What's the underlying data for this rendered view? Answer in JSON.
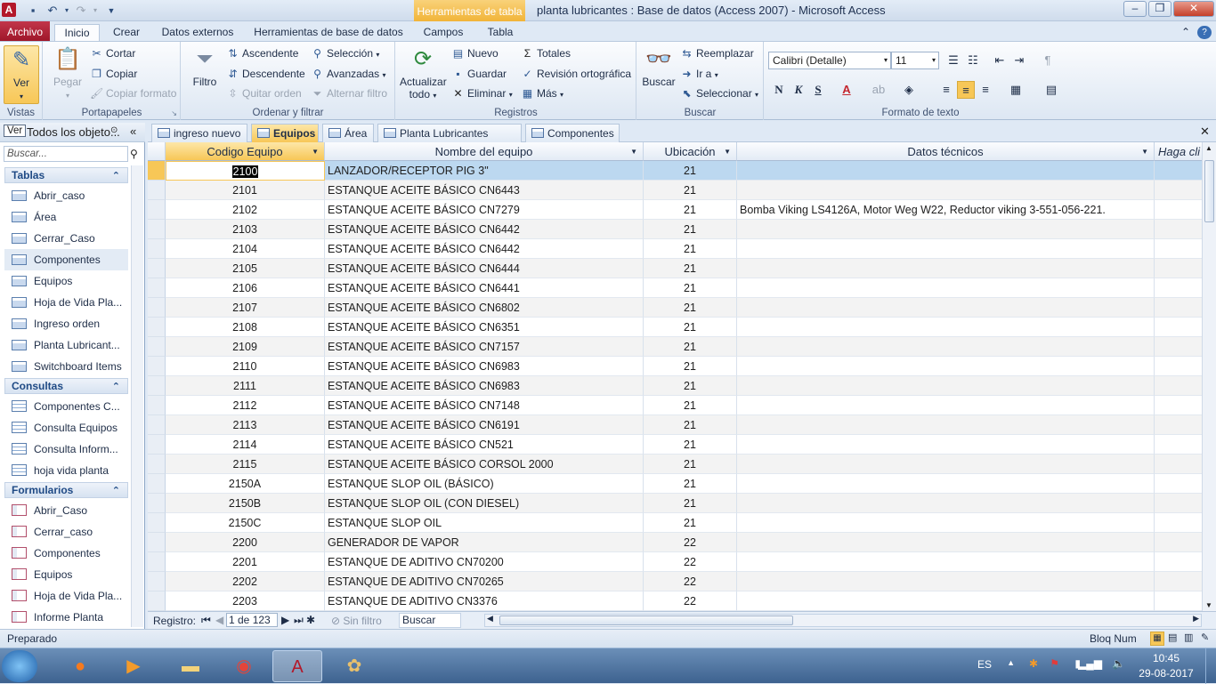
{
  "window": {
    "app_title": "planta lubricantes : Base de datos (Access 2007)  -  Microsoft Access",
    "contextual_header": "Herramientas de tabla",
    "app_icon_letter": "A"
  },
  "ribbon_tabs": [
    "Archivo",
    "Inicio",
    "Crear",
    "Datos externos",
    "Herramientas de base de datos",
    "Campos",
    "Tabla"
  ],
  "ribbon": {
    "vistas": {
      "label": "Vistas",
      "ver": "Ver"
    },
    "portapapeles": {
      "label": "Portapapeles",
      "pegar": "Pegar",
      "cortar": "Cortar",
      "copiar": "Copiar",
      "copiar_formato": "Copiar formato"
    },
    "ordenar": {
      "label": "Ordenar y filtrar",
      "filtro": "Filtro",
      "ascendente": "Ascendente",
      "descendente": "Descendente",
      "quitar_orden": "Quitar orden",
      "seleccion": "Selección",
      "avanzadas": "Avanzadas",
      "alternar_filtro": "Alternar filtro"
    },
    "registros": {
      "label": "Registros",
      "actualizar": "Actualizar",
      "todo": "todo",
      "nuevo": "Nuevo",
      "guardar": "Guardar",
      "eliminar": "Eliminar",
      "totales": "Totales",
      "revision": "Revisión ortográfica",
      "mas": "Más"
    },
    "buscar": {
      "label": "Buscar",
      "buscar": "Buscar",
      "reemplazar": "Reemplazar",
      "ir_a": "Ir a",
      "seleccionar": "Seleccionar"
    },
    "formato": {
      "label": "Formato de texto",
      "font_name": "Calibri (Detalle)",
      "font_size": "11",
      "bold": "N",
      "italic": "K",
      "underline": "S"
    }
  },
  "nav": {
    "header": "Todos los objeto...",
    "ver_tooltip": "Ver",
    "search_placeholder": "Buscar...",
    "sections": [
      {
        "title": "Tablas",
        "items": [
          "Abrir_caso",
          "Área",
          "Cerrar_Caso",
          "Componentes",
          "Equipos",
          "Hoja de Vida Pla...",
          "Ingreso orden",
          "Planta Lubricant...",
          "Switchboard Items"
        ]
      },
      {
        "title": "Consultas",
        "items": [
          "Componentes C...",
          "Consulta Equipos",
          "Consulta Inform...",
          "hoja vida planta"
        ]
      },
      {
        "title": "Formularios",
        "items": [
          "Abrir_Caso",
          "Cerrar_caso",
          "Componentes",
          "Equipos",
          "Hoja de Vida Pla...",
          "Informe Planta"
        ]
      }
    ]
  },
  "doc_tabs": [
    "ingreso nuevo",
    "Equipos",
    "Área",
    "Planta Lubricantes Copec",
    "Componentes"
  ],
  "table": {
    "columns": [
      "Codigo Equipo",
      "Nombre del equipo",
      "Ubicación",
      "Datos técnicos",
      "Haga cli"
    ],
    "rows": [
      [
        "2100",
        "LANZADOR/RECEPTOR PIG 3\"",
        "21",
        ""
      ],
      [
        "2101",
        "ESTANQUE ACEITE BÁSICO CN6443",
        "21",
        ""
      ],
      [
        "2102",
        "ESTANQUE ACEITE BÁSICO CN7279",
        "21",
        "Bomba Viking LS4126A, Motor Weg W22, Reductor viking 3-551-056-221."
      ],
      [
        "2103",
        "ESTANQUE ACEITE BÁSICO CN6442",
        "21",
        ""
      ],
      [
        "2104",
        "ESTANQUE ACEITE BÁSICO CN6442",
        "21",
        ""
      ],
      [
        "2105",
        "ESTANQUE ACEITE BÁSICO CN6444",
        "21",
        ""
      ],
      [
        "2106",
        "ESTANQUE ACEITE BÁSICO CN6441",
        "21",
        ""
      ],
      [
        "2107",
        "ESTANQUE ACEITE BÁSICO CN6802",
        "21",
        ""
      ],
      [
        "2108",
        "ESTANQUE ACEITE BÁSICO CN6351",
        "21",
        ""
      ],
      [
        "2109",
        "ESTANQUE ACEITE BÁSICO CN7157",
        "21",
        ""
      ],
      [
        "2110",
        "ESTANQUE ACEITE BÁSICO CN6983",
        "21",
        ""
      ],
      [
        "2111",
        "ESTANQUE ACEITE BÁSICO CN6983",
        "21",
        ""
      ],
      [
        "2112",
        "ESTANQUE ACEITE BÁSICO CN7148",
        "21",
        ""
      ],
      [
        "2113",
        "ESTANQUE ACEITE BÁSICO CN6191",
        "21",
        ""
      ],
      [
        "2114",
        "ESTANQUE ACEITE BÁSICO CN521",
        "21",
        ""
      ],
      [
        "2115",
        "ESTANQUE ACEITE BÁSICO CORSOL 2000",
        "21",
        ""
      ],
      [
        "2150A",
        "ESTANQUE SLOP OIL (BÁSICO)",
        "21",
        ""
      ],
      [
        "2150B",
        "ESTANQUE SLOP OIL (CON DIESEL)",
        "21",
        ""
      ],
      [
        "2150C",
        "ESTANQUE SLOP OIL",
        "21",
        ""
      ],
      [
        "2200",
        "GENERADOR DE VAPOR",
        "22",
        ""
      ],
      [
        "2201",
        "ESTANQUE DE ADITIVO CN70200",
        "22",
        ""
      ],
      [
        "2202",
        "ESTANQUE DE ADITIVO CN70265",
        "22",
        ""
      ],
      [
        "2203",
        "ESTANQUE DE ADITIVO CN3376",
        "22",
        ""
      ]
    ]
  },
  "record_nav": {
    "label": "Registro:",
    "position": "1 de 123",
    "filter": "Sin filtro",
    "search": "Buscar"
  },
  "status": {
    "left": "Preparado",
    "right": "Bloq Num"
  },
  "taskbar": {
    "lang": "ES",
    "time": "10:45",
    "date": "29-08-2017"
  },
  "colors": {
    "accent": "#f7c757",
    "file_tab": "#b3182a",
    "selected_row": "#bcd8f0"
  }
}
